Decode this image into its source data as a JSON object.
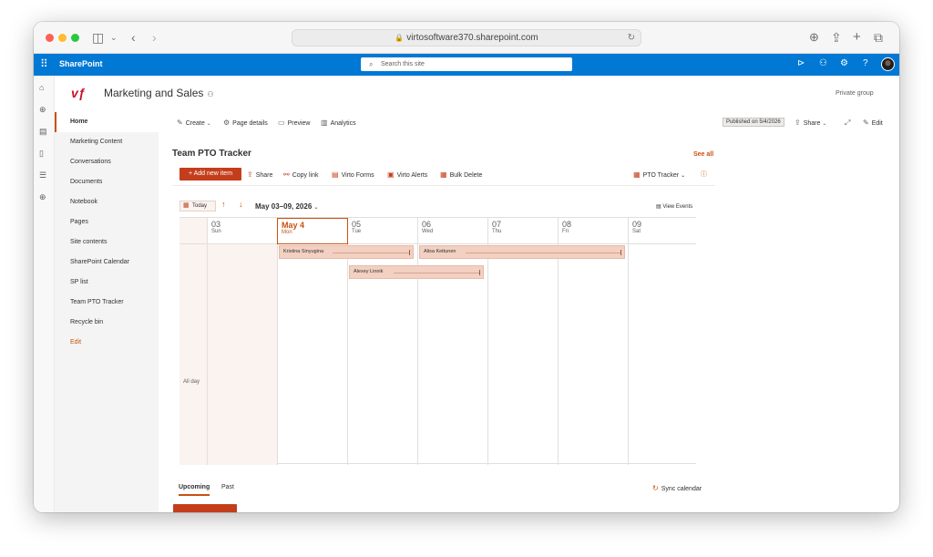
{
  "browser": {
    "url": "virtosoftware370.sharepoint.com",
    "icons": [
      "sidebar-icon",
      "chevron-down-icon",
      "back-icon",
      "forward-icon",
      "lock-icon",
      "reload-icon",
      "download-icon",
      "share-icon",
      "new-tab-icon",
      "tabs-icon"
    ]
  },
  "suite": {
    "brand": "SharePoint",
    "search_placeholder": "Search this site"
  },
  "site": {
    "title": "Marketing and Sales",
    "privacy": "Private group"
  },
  "nav": {
    "items": [
      {
        "label": "Home",
        "active": true
      },
      {
        "label": "Marketing Content"
      },
      {
        "label": "Conversations"
      },
      {
        "label": "Documents"
      },
      {
        "label": "Notebook"
      },
      {
        "label": "Pages"
      },
      {
        "label": "Site contents"
      },
      {
        "label": "SharePoint Calendar"
      },
      {
        "label": "SP list"
      },
      {
        "label": "Team PTO Tracker"
      },
      {
        "label": "Recycle bin"
      }
    ],
    "edit": "Edit"
  },
  "commandbar": {
    "create": "Create",
    "page_details": "Page details",
    "preview": "Preview",
    "analytics": "Analytics",
    "published": "Published on 5/4/2026",
    "share": "Share",
    "edit": "Edit"
  },
  "webpart": {
    "title": "Team PTO Tracker",
    "see_all": "See all",
    "add_new": "Add new item",
    "share": "Share",
    "copy_link": "Copy link",
    "virto_forms": "Virto Forms",
    "virto_alerts": "Virto Alerts",
    "bulk_delete": "Bulk Delete",
    "view_selector": "PTO Tracker"
  },
  "calendar": {
    "today_label": "Today",
    "range": "May 03–09, 2026",
    "view_events": "View Events",
    "all_day": "All day",
    "days": [
      {
        "num": "03",
        "weekday": "Sun"
      },
      {
        "num": "May 4",
        "weekday": "Mon",
        "today": true
      },
      {
        "num": "05",
        "weekday": "Tue"
      },
      {
        "num": "06",
        "weekday": "Wed"
      },
      {
        "num": "07",
        "weekday": "Thu"
      },
      {
        "num": "08",
        "weekday": "Fri"
      },
      {
        "num": "09",
        "weekday": "Sat"
      }
    ],
    "events": [
      {
        "name": "Kristina Sinyugina",
        "start_day": "May 4",
        "end_day": "05"
      },
      {
        "name": "Alisa Kettunen",
        "start_day": "06",
        "end_day": "08"
      },
      {
        "name": "Alexey Linnik",
        "start_day": "05",
        "end_day": "06"
      }
    ]
  },
  "tabs": {
    "upcoming": "Upcoming",
    "past": "Past",
    "sync": "Sync calendar"
  },
  "colors": {
    "suite_blue": "#0078d4",
    "accent": "#ca5010",
    "button": "#c43e1c",
    "event_fill": "#f2d0c2"
  }
}
